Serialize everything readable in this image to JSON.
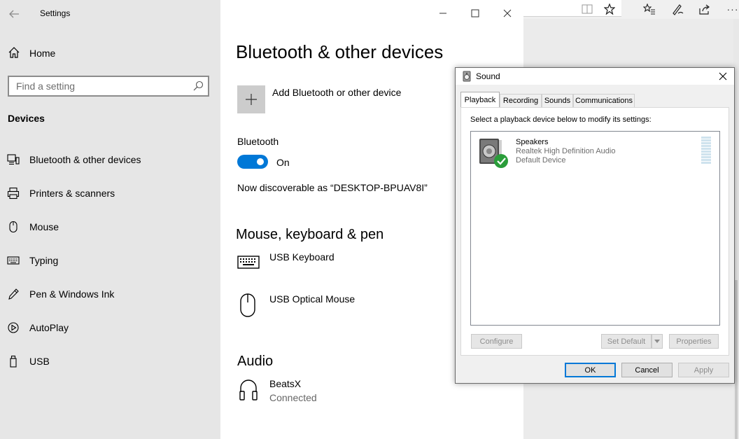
{
  "settings": {
    "window_title": "Settings",
    "sidebar": {
      "home_label": "Home",
      "search_placeholder": "Find a setting",
      "section_title": "Devices",
      "items": [
        {
          "label": "Bluetooth & other devices",
          "icon": "bluetooth-devices-icon"
        },
        {
          "label": "Printers & scanners",
          "icon": "printer-icon"
        },
        {
          "label": "Mouse",
          "icon": "mouse-icon"
        },
        {
          "label": "Typing",
          "icon": "keyboard-icon"
        },
        {
          "label": "Pen & Windows Ink",
          "icon": "pen-icon"
        },
        {
          "label": "AutoPlay",
          "icon": "autoplay-icon"
        },
        {
          "label": "USB",
          "icon": "usb-icon"
        }
      ]
    },
    "main": {
      "title": "Bluetooth & other devices",
      "add_device_label": "Add Bluetooth or other device",
      "bluetooth_label": "Bluetooth",
      "bluetooth_state": "On",
      "discoverable_text": "Now discoverable as “DESKTOP-BPUAV8I”",
      "mkp_heading": "Mouse, keyboard & pen",
      "mkp_devices": [
        {
          "name": "USB Keyboard",
          "icon": "keyboard-icon"
        },
        {
          "name": "USB Optical Mouse",
          "icon": "mouse-icon"
        }
      ],
      "audio_heading": "Audio",
      "audio_devices": [
        {
          "name": "BeatsX",
          "status": "Connected",
          "icon": "headphones-icon"
        }
      ]
    }
  },
  "sound_dialog": {
    "title": "Sound",
    "tabs": [
      "Playback",
      "Recording",
      "Sounds",
      "Communications"
    ],
    "active_tab": "Playback",
    "instruction": "Select a playback device below to modify its settings:",
    "device": {
      "name": "Speakers",
      "driver": "Realtek High Definition Audio",
      "status": "Default Device"
    },
    "buttons": {
      "configure": "Configure",
      "set_default": "Set Default",
      "properties": "Properties",
      "ok": "OK",
      "cancel": "Cancel",
      "apply": "Apply"
    }
  },
  "colors": {
    "accent": "#0078d7",
    "sidebar_bg": "#e6e6e6",
    "dialog_bg": "#f0f0f0",
    "check_green": "#2a9d3a"
  }
}
